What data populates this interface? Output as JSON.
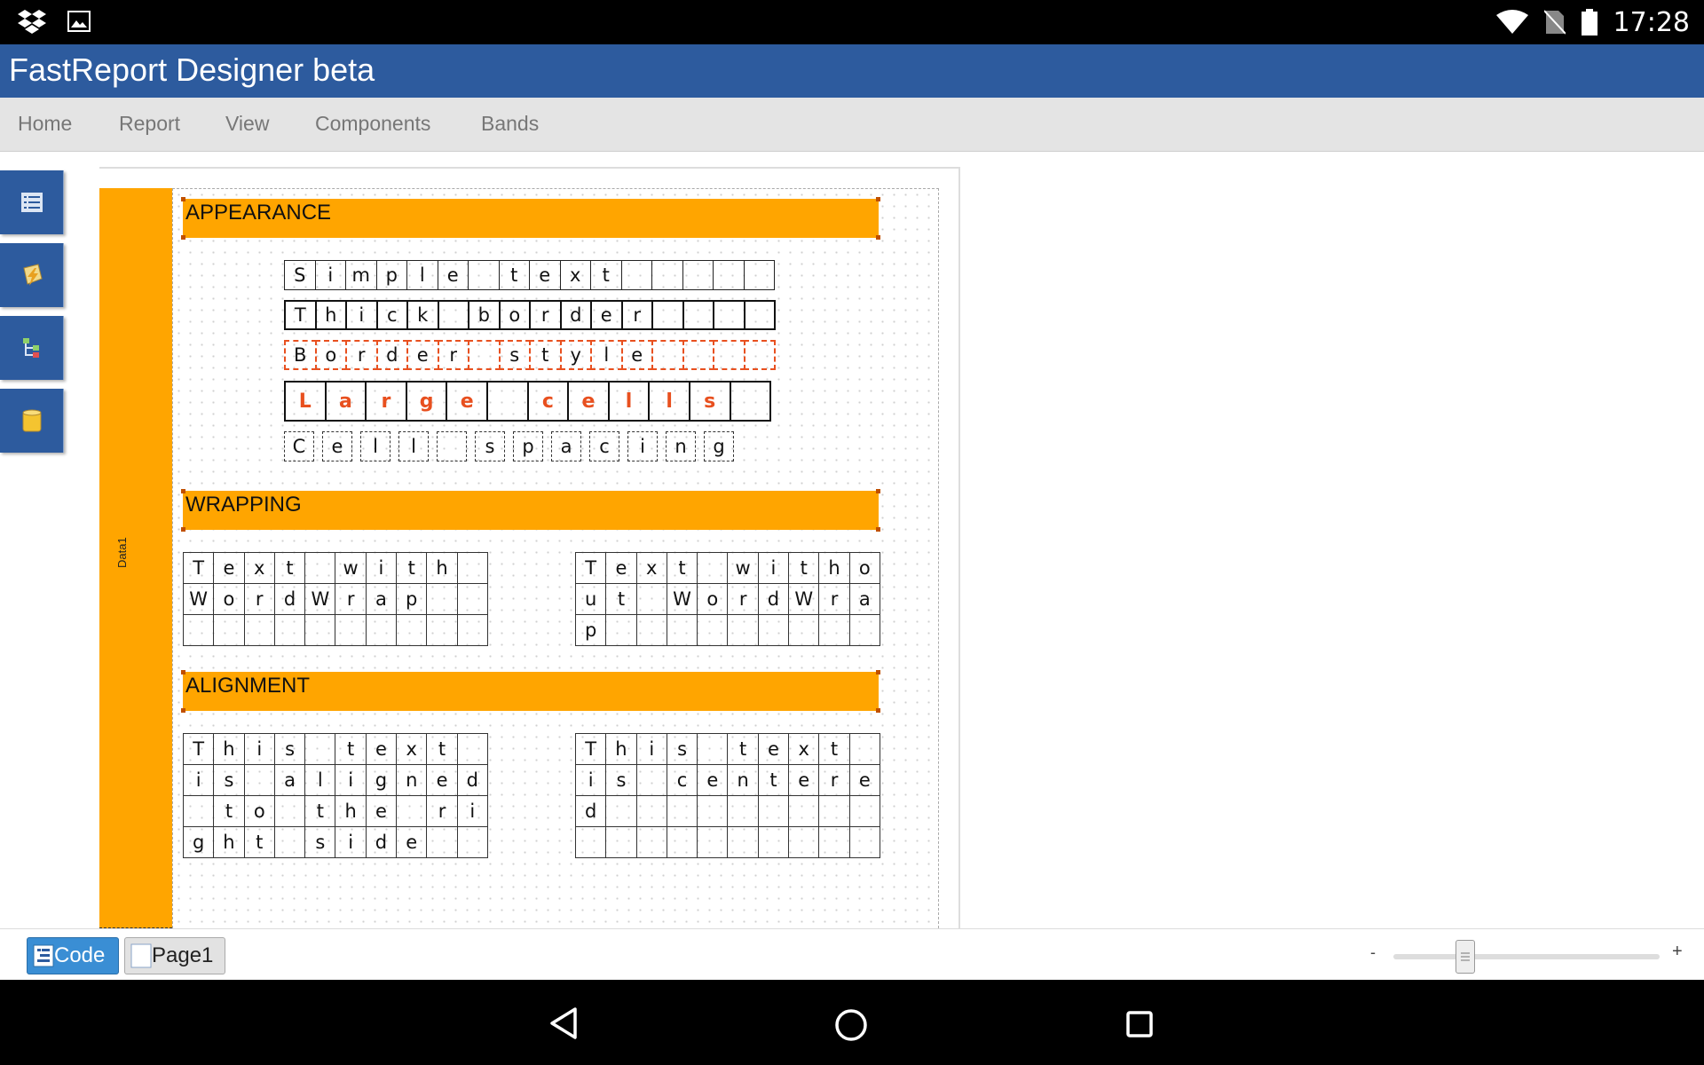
{
  "status": {
    "time": "17:28"
  },
  "app": {
    "title": "FastReport Designer beta"
  },
  "menu": [
    "Home",
    "Report",
    "View",
    "Components",
    "Bands"
  ],
  "tools": [
    "data-list-icon",
    "script-icon",
    "tree-icon",
    "database-icon"
  ],
  "band": {
    "label": "Data1"
  },
  "sections": {
    "appearance": "APPEARANCE",
    "wrapping": "WRAPPING",
    "alignment": "ALIGNMENT"
  },
  "appearance": {
    "simple": [
      "S",
      "i",
      "m",
      "p",
      "l",
      "e",
      "",
      "t",
      "e",
      "x",
      "t",
      "",
      "",
      "",
      "",
      ""
    ],
    "thick": [
      "T",
      "h",
      "i",
      "c",
      "k",
      "",
      "b",
      "o",
      "r",
      "d",
      "e",
      "r",
      "",
      "",
      "",
      ""
    ],
    "border_style": [
      "B",
      "o",
      "r",
      "d",
      "e",
      "r",
      "",
      "s",
      "t",
      "y",
      "l",
      "e",
      "",
      "",
      "",
      ""
    ],
    "large": [
      "L",
      "a",
      "r",
      "g",
      "e",
      "",
      "c",
      "e",
      "l",
      "l",
      "s",
      ""
    ],
    "spacing": [
      "C",
      "e",
      "l",
      "l",
      "",
      "s",
      "p",
      "a",
      "c",
      "i",
      "n",
      "g"
    ]
  },
  "wrapping": {
    "with": [
      [
        "T",
        "e",
        "x",
        "t",
        "",
        "w",
        "i",
        "t",
        "h",
        ""
      ],
      [
        "W",
        "o",
        "r",
        "d",
        "W",
        "r",
        "a",
        "p",
        "",
        ""
      ],
      [
        "",
        "",
        "",
        "",
        "",
        "",
        "",
        "",
        "",
        ""
      ]
    ],
    "without": [
      [
        "T",
        "e",
        "x",
        "t",
        "",
        "w",
        "i",
        "t",
        "h",
        "o"
      ],
      [
        "u",
        "t",
        "",
        "W",
        "o",
        "r",
        "d",
        "W",
        "r",
        "a"
      ],
      [
        "p",
        "",
        "",
        "",
        "",
        "",
        "",
        "",
        "",
        ""
      ]
    ]
  },
  "alignment": {
    "right": [
      [
        "T",
        "h",
        "i",
        "s",
        "",
        "t",
        "e",
        "x",
        "t",
        ""
      ],
      [
        "i",
        "s",
        "",
        "a",
        "l",
        "i",
        "g",
        "n",
        "e",
        "d"
      ],
      [
        "",
        "t",
        "o",
        "",
        "t",
        "h",
        "e",
        "",
        "r",
        "i"
      ],
      [
        "g",
        "h",
        "t",
        "",
        "s",
        "i",
        "d",
        "e",
        "",
        ""
      ]
    ],
    "center": [
      [
        "T",
        "h",
        "i",
        "s",
        "",
        "t",
        "e",
        "x",
        "t",
        ""
      ],
      [
        "i",
        "s",
        "",
        "c",
        "e",
        "n",
        "t",
        "e",
        "r",
        "e"
      ],
      [
        "d",
        "",
        "",
        "",
        "",
        "",
        "",
        "",
        "",
        ""
      ],
      [
        "",
        "",
        "",
        "",
        "",
        "",
        "",
        "",
        "",
        ""
      ]
    ]
  },
  "bottom": {
    "code_tab": "Code",
    "page_tab": "Page1",
    "zoom_minus": "-",
    "zoom_plus": "+"
  }
}
